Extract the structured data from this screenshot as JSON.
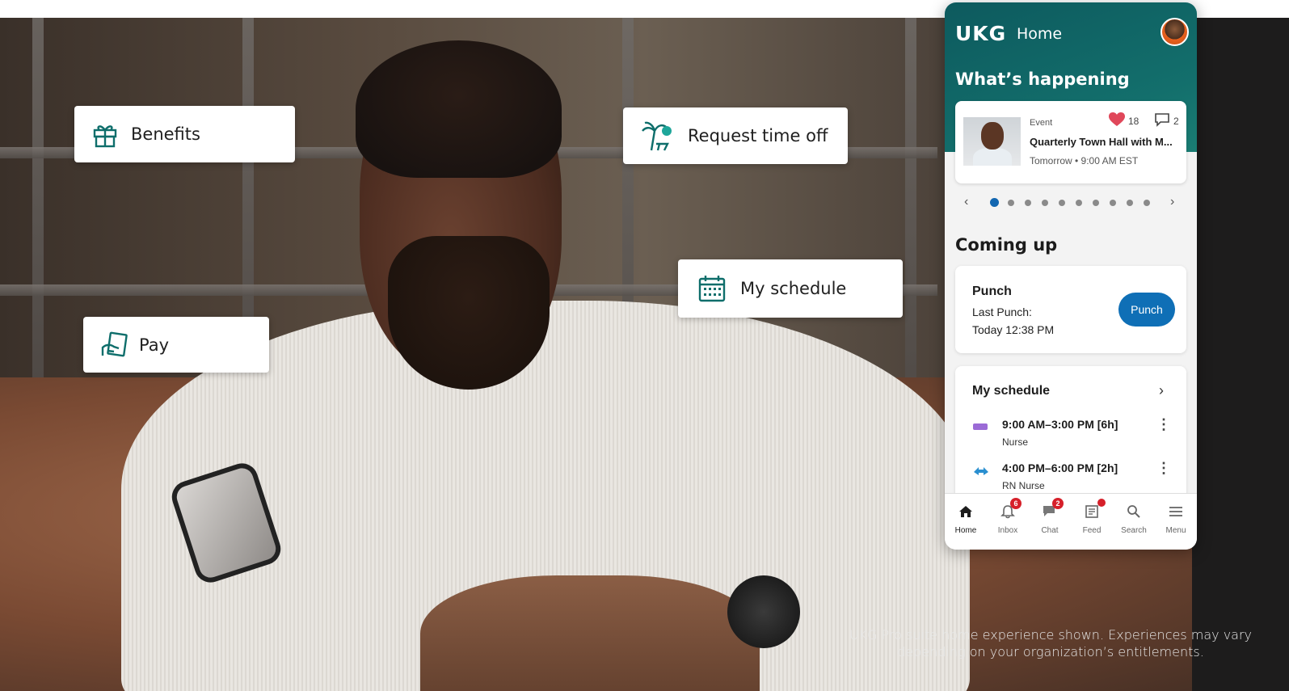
{
  "cards": {
    "benefits": "Benefits",
    "request_time_off": "Request time off",
    "my_schedule": "My schedule",
    "pay": "Pay"
  },
  "app": {
    "logo": "UKG",
    "title": "Home",
    "whats_happening": "What’s happening",
    "event": {
      "type": "Event",
      "name": "Quarterly Town Hall with M...",
      "time": "Tomorrow • 9:00 AM EST",
      "likes": "18",
      "comments": "2"
    },
    "carousel": {
      "total": 10,
      "active": 0
    },
    "coming_up": "Coming up",
    "punch": {
      "title": "Punch",
      "last_label": "Last Punch:",
      "last_time": "Today 12:38 PM",
      "button": "Punch"
    },
    "schedule": {
      "title": "My schedule",
      "shifts": [
        {
          "time": "9:00 AM–3:00 PM [6h]",
          "role": "Nurse",
          "icon": "shift-bar-icon",
          "color": "#9b6bd6"
        },
        {
          "time": "4:00 PM–6:00 PM [2h]",
          "role": "RN Nurse",
          "icon": "swap-arrows-icon",
          "color": "#2a8fd0"
        }
      ]
    },
    "tabs": [
      {
        "label": "Home",
        "icon": "home-icon",
        "badge": ""
      },
      {
        "label": "Inbox",
        "icon": "bell-icon",
        "badge": "6"
      },
      {
        "label": "Chat",
        "icon": "chat-icon",
        "badge": "2"
      },
      {
        "label": "Feed",
        "icon": "feed-icon",
        "badge": "dot"
      },
      {
        "label": "Search",
        "icon": "search-icon",
        "badge": ""
      },
      {
        "label": "Menu",
        "icon": "menu-icon",
        "badge": ""
      }
    ]
  },
  "disclaimer": {
    "line1": "UKG Pro suite home experience shown. Experiences may vary",
    "line2": "depending on your organization’s entitlements."
  },
  "colors": {
    "brand_teal": "#136f6c",
    "punch_blue": "#0f6fb6",
    "badge_red": "#d6202a"
  }
}
